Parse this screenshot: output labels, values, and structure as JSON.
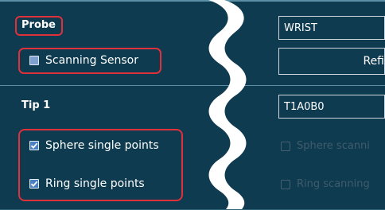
{
  "probe": {
    "label": "Probe",
    "scanning_sensor": {
      "label": "Scanning Sensor",
      "checked": false
    },
    "selected": "WRIST",
    "action_button_partial": "Refi"
  },
  "tip": {
    "label": "Tip 1",
    "selected": "T1A0B0",
    "sphere_single_points": {
      "label": "Sphere single points",
      "checked": true
    },
    "ring_single_points": {
      "label": "Ring single points",
      "checked": true
    },
    "sphere_scanning_partial": {
      "label": "Sphere scanni",
      "checked": false,
      "enabled": false
    },
    "ring_scanning_partial": {
      "label": "Ring scanning",
      "checked": false,
      "enabled": false
    }
  },
  "colors": {
    "panel_background": "#0e3b50",
    "highlight_outline": "#e0303a",
    "separator": "#5d8ea4"
  }
}
